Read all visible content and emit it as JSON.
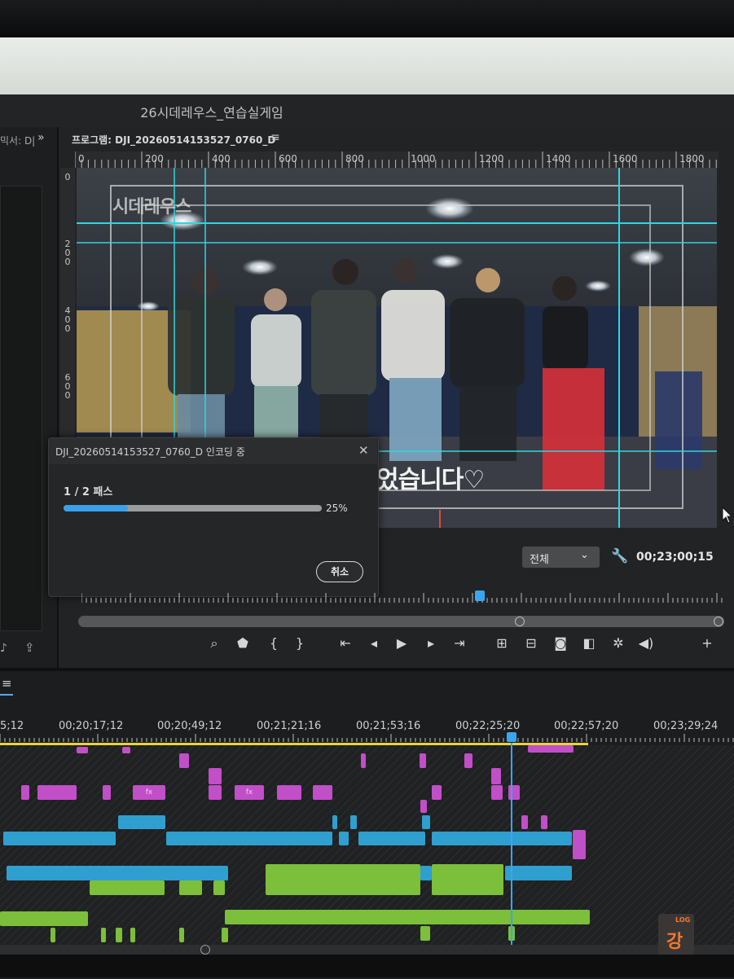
{
  "app_title": "26시데레우스_연습실게임",
  "left_panel": {
    "label": "믹서: D|",
    "chevron": "»"
  },
  "monitor": {
    "title": "프로그램: DJI_20260514153527_0760_D",
    "menu_icon": "≡",
    "ruler_labels": [
      "0",
      "200",
      "400",
      "600",
      "800",
      "1000",
      "1200",
      "1400",
      "1600",
      "1800"
    ],
    "vruler_labels": [
      "0",
      "200",
      "400",
      "600"
    ],
    "overlay_text": "시데레우스",
    "caption_text": "었습니다♡",
    "zoom_value": "전체",
    "timecode": "00;23;00;15",
    "playhead_fraction": 0.62
  },
  "encode_dialog": {
    "title": "DJI_20260514153527_0760_D 인코딩 중",
    "close_icon": "✕",
    "pass_text": "1 / 2 패스",
    "progress_percent": 25,
    "progress_label": "25%",
    "cancel_label": "취소"
  },
  "transport_icons": [
    "zoom-fit-icon",
    "marker-icon",
    "mark-in-icon",
    "mark-out-icon",
    "go-to-in-icon",
    "step-back-icon",
    "play-icon",
    "step-forward-icon",
    "go-to-out-icon",
    "lift-icon",
    "extract-icon",
    "camera-icon",
    "compare-icon",
    "settings-icon",
    "speaker-icon",
    "add-icon"
  ],
  "timeline": {
    "menu_icon": "≡",
    "timecodes": [
      "5;12",
      "00;20;17;12",
      "00;20;49;12",
      "00;21;21;16",
      "00;21;53;16",
      "00;22;25;20",
      "00;22;57;20",
      "00;23;29;24"
    ],
    "fx_label": "fx"
  },
  "watermark": {
    "top": "LOG",
    "main": "강"
  },
  "colors": {
    "accent": "#3aa6f0",
    "video_clip": "#c04fc8",
    "linked_clip": "#2f9fd0",
    "audio_clip": "#7bbf3a",
    "work_area": "#e9d43a"
  }
}
